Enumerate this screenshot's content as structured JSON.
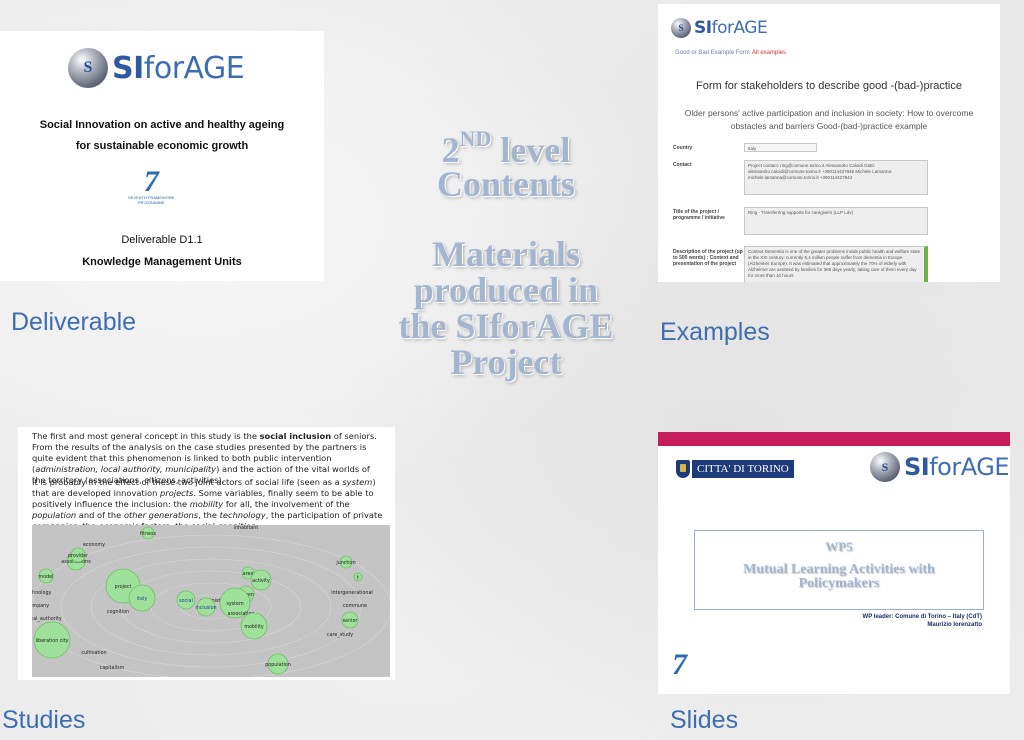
{
  "center": {
    "level_num": "2",
    "level_sup": "ND",
    "level_word": " level",
    "contents": "Contents",
    "materials_lines": [
      "Materials",
      "produced in",
      "the SIforAGE",
      "Project"
    ]
  },
  "captions": {
    "deliverable": "Deliverable",
    "examples": "Examples",
    "studies": "Studies",
    "slides": "Slides"
  },
  "logo": {
    "si": "SI",
    "for_age": "forAGE"
  },
  "deliverable_card": {
    "title_line1": "Social Innovation on active and healthy ageing",
    "title_line2": "for sustainable economic growth",
    "fp7_seven": "7",
    "fp7_caption_line1": "SEVENTH FRAMEWORK",
    "fp7_caption_line2": "PROGRAMME",
    "deliverable_id": "Deliverable D1.1",
    "deliverable_name": "Knowledge Management Units"
  },
  "examples_card": {
    "tab1": "Good or Bad Example Form",
    "tab2": "All examples",
    "form_title": "Form for stakeholders to describe good -(bad-)practice",
    "subtitle_line1": "Older persons' active participation and inclusion in society: How to overcome",
    "subtitle_line2": "obstacles and barriers Good-(bad-)practice example",
    "country_label": "Country",
    "country_value": "Italy",
    "contact_label": "Contact",
    "contact_value": "Project contact: ring@comune.torino.it Alessandro Caloidi Gatti: alessandro.caloidi@comune.torino.it +390114427845 Michele Lamanna: michele.lamanna@comune.torino.it +390114427844",
    "title_label": "Title of the project / programme / initiative",
    "title_value": "Ring - Transferring supports for caregivers (LLP Ldv)",
    "desc_label": "Description of the project (up to 500 words) : Context and presentation of the project",
    "desc_value": "Context Dementia is one of the greater problems inside public health and welfare state in the XXI century: currently 5,4 million people suffer from dementia in Europe (Alzheimer Europe). It was estimated that approximately the 70% of elderly with Alzheimer are assisted by families for 365 days yearly, taking care of them every day for more than 10 hours"
  },
  "studies_card": {
    "para1_a": "The first and most general concept in this study is the ",
    "para1_b": "social inclusion",
    "para1_c": " of seniors. From the results of the analysis on the case studies presented by the partners is quite evident that this phenomenon is linked to both public intervention (",
    "para1_d": "administration, local authority, municipality",
    "para1_e": ") and the action of the vital worlds of the territory (associations, citizens, activities).",
    "para2_a": "It is probably in the effect of these two joint actors of social life (seen as a ",
    "para2_b": "system",
    "para2_c": ") that are developed innovation ",
    "para2_d": "projects",
    "para2_e": ". Some variables, finally seem to be able to positively influence the inclusion: the ",
    "para2_f": "mobility",
    "para2_g": " for all, the involvement of the ",
    "para2_h": "population",
    "para2_i": " and of the ",
    "para2_j": "other generations",
    "para2_k": ", the ",
    "para2_l": "technology",
    "para2_m": ", the participation of private ",
    "para2_n": "companies",
    "para2_o": ", the ",
    "para2_p": "economic",
    "para2_q": " factors, the social ",
    "para2_r": "cognition",
    "para2_s": ".",
    "bubbles": [
      {
        "label": "fitness",
        "r": 6,
        "c": [
          130,
          106
        ]
      },
      {
        "label": "inhabitant",
        "r": 0,
        "c": [
          228,
          100
        ]
      },
      {
        "label": "economy",
        "r": 0,
        "c": [
          76,
          117
        ]
      },
      {
        "label": "associations",
        "r": 9,
        "c": [
          58,
          134
        ]
      },
      {
        "label": "provider",
        "r": 7,
        "c": [
          60,
          128
        ]
      },
      {
        "label": "model",
        "r": 7,
        "c": [
          28,
          149
        ]
      },
      {
        "label": "junction",
        "r": 6,
        "c": [
          328,
          135
        ]
      },
      {
        "label": "t",
        "r": 4,
        "c": [
          340,
          150
        ]
      },
      {
        "label": "area",
        "r": 6,
        "c": [
          230,
          146
        ]
      },
      {
        "label": "activity",
        "r": 10,
        "c": [
          243,
          153
        ]
      },
      {
        "label": "project",
        "r": 17,
        "c": [
          105,
          159
        ]
      },
      {
        "label": "italy",
        "r": 13,
        "c": [
          124,
          171
        ]
      },
      {
        "label": "technology",
        "r": 0,
        "c": [
          20,
          165
        ]
      },
      {
        "label": "intergenerational",
        "r": 0,
        "c": [
          334,
          165
        ]
      },
      {
        "label": "social",
        "r": 9,
        "c": [
          168,
          173
        ]
      },
      {
        "label": "administration",
        "r": 0,
        "c": [
          199,
          173
        ]
      },
      {
        "label": "citizen",
        "r": 8,
        "c": [
          228,
          167
        ]
      },
      {
        "label": "company",
        "r": 0,
        "c": [
          20,
          178
        ]
      },
      {
        "label": "commune",
        "r": 0,
        "c": [
          337,
          178
        ]
      },
      {
        "label": "inclusion",
        "r": 9,
        "c": [
          188,
          180
        ]
      },
      {
        "label": "system",
        "r": 15,
        "c": [
          217,
          176
        ]
      },
      {
        "label": "association",
        "r": 0,
        "c": [
          223,
          186
        ]
      },
      {
        "label": "cognition",
        "r": 0,
        "c": [
          100,
          184
        ]
      },
      {
        "label": "local_authority",
        "r": 0,
        "c": [
          26,
          191
        ]
      },
      {
        "label": "senior",
        "r": 8,
        "c": [
          332,
          193
        ]
      },
      {
        "label": "mobility",
        "r": 13,
        "c": [
          236,
          199
        ]
      },
      {
        "label": "care_study",
        "r": 0,
        "c": [
          322,
          207
        ]
      },
      {
        "label": "liberation city",
        "r": 18,
        "c": [
          34,
          213
        ]
      },
      {
        "label": "cultivation",
        "r": 0,
        "c": [
          76,
          225
        ]
      },
      {
        "label": "capitalism",
        "r": 0,
        "c": [
          94,
          240
        ]
      },
      {
        "label": "population",
        "r": 10,
        "c": [
          260,
          237
        ]
      }
    ]
  },
  "slides_card": {
    "city_name": "CITTA' DI TORINO",
    "wp": "WP5",
    "wp_title_line1": "Mutual Learning  Activities with",
    "wp_title_line2": "Policymakers",
    "wp_leader_line1": "WP leader: Comune di Torino – Italy (CdT)",
    "wp_leader_line2": "Maurizio Iorenzatto",
    "fp7_seven": "7"
  },
  "colors": {
    "caption_blue": "#3f6eb0",
    "title_steel": "#a4b5cf",
    "slides_bar": "#c51e5a",
    "bubble_green": "#9fe19a"
  }
}
